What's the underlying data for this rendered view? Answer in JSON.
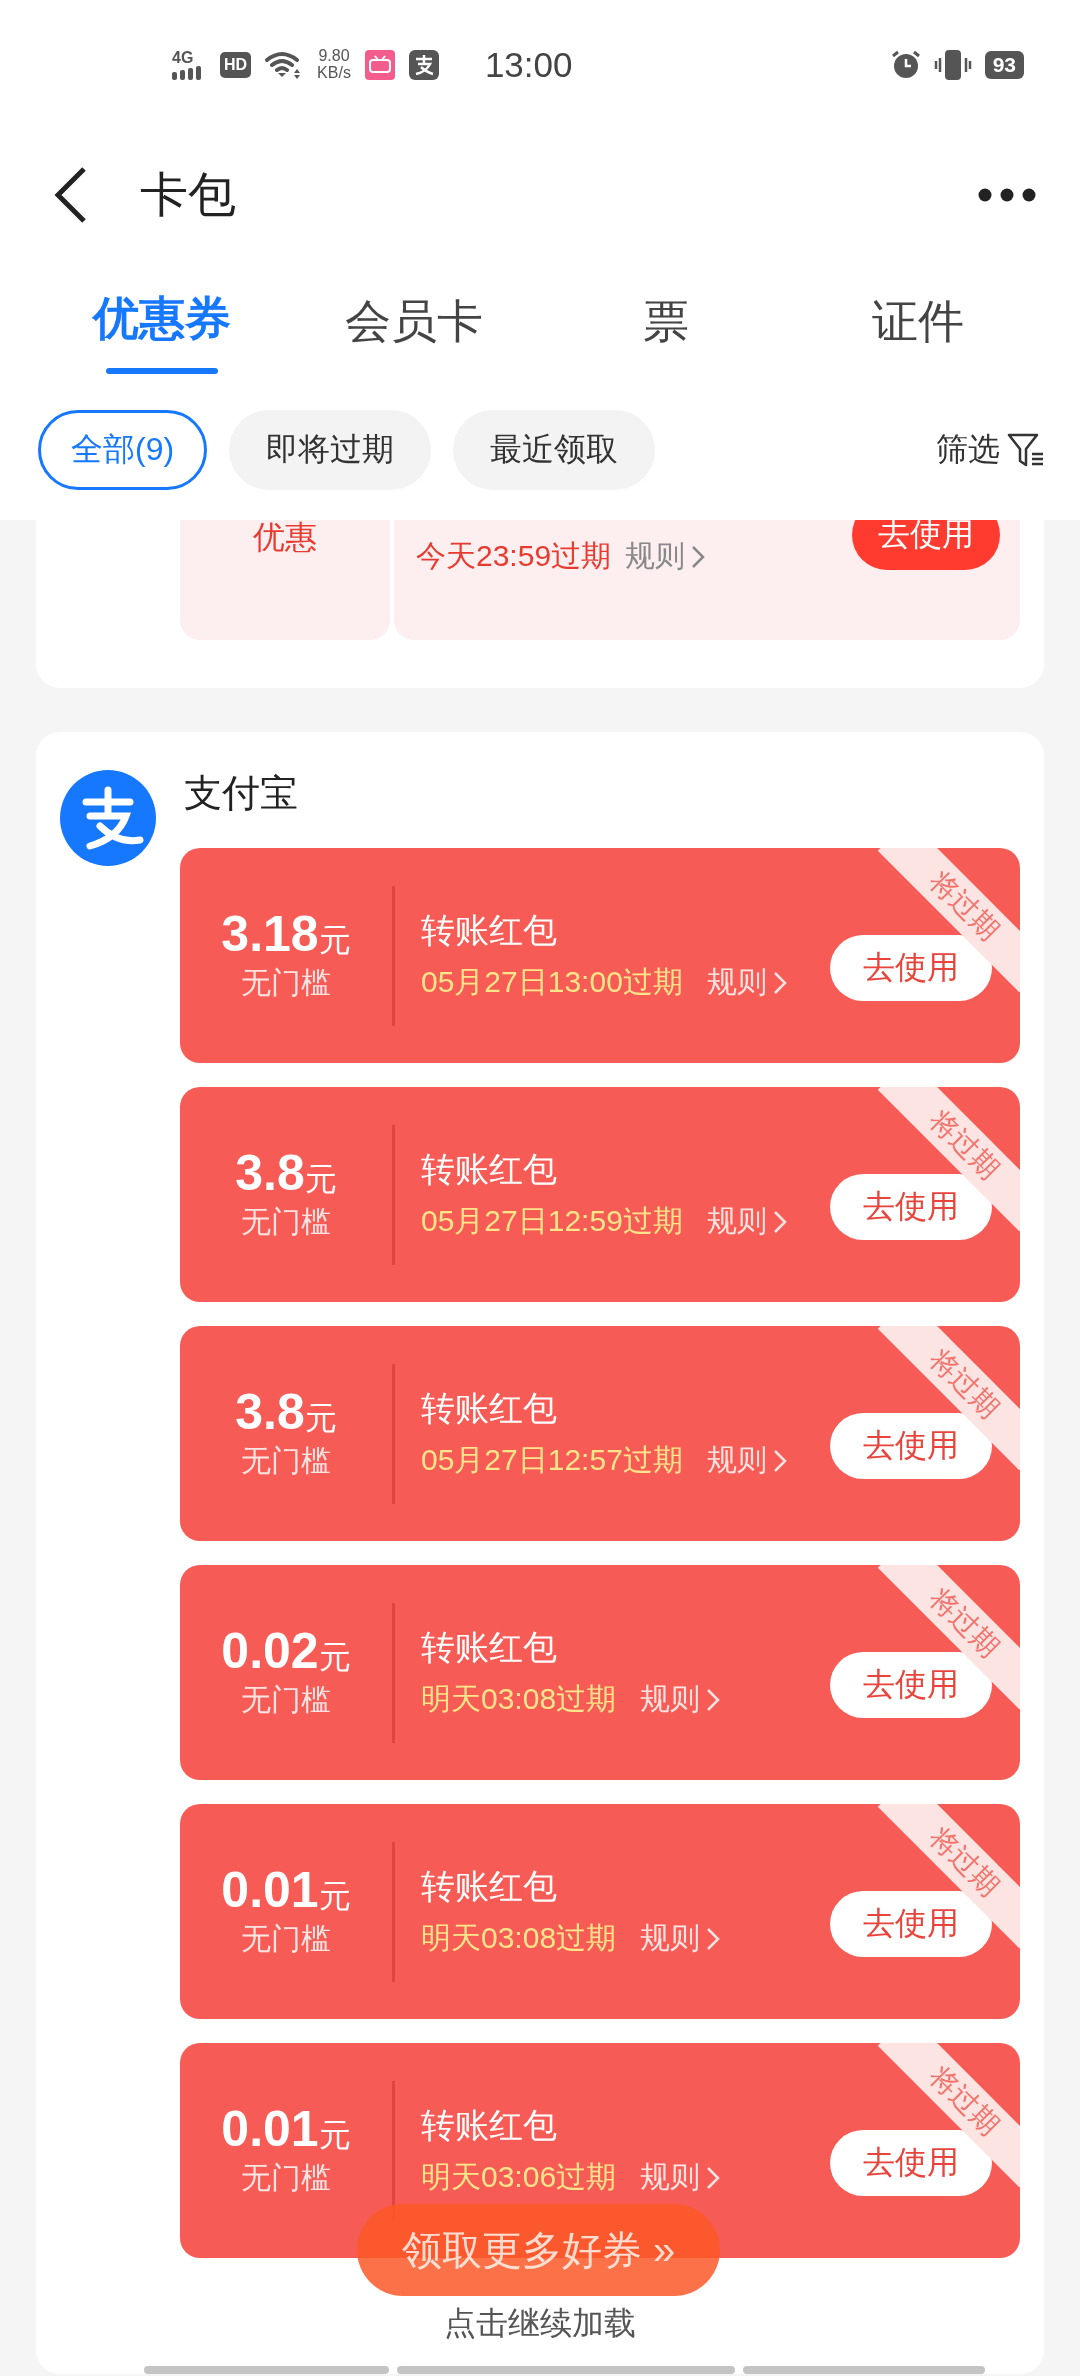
{
  "status_bar": {
    "network": "4G",
    "hd_badge": "HD",
    "speed": "9.80",
    "speed_unit": "KB/s",
    "time": "13:00",
    "battery": "93"
  },
  "header": {
    "title": "卡包"
  },
  "tabs": [
    {
      "label": "优惠券",
      "selected": true
    },
    {
      "label": "会员卡",
      "selected": false
    },
    {
      "label": "票",
      "selected": false
    },
    {
      "label": "证件",
      "selected": false
    }
  ],
  "filters": [
    {
      "label": "全部(9)",
      "selected": true
    },
    {
      "label": "即将过期",
      "selected": false
    },
    {
      "label": "最近领取",
      "selected": false
    }
  ],
  "filter_button": "筛选",
  "partial_coupon": {
    "left_label": "优惠",
    "expiry": "今天23:59过期",
    "rules": "规则",
    "action": "去使用"
  },
  "merchant": {
    "name": "支付宝",
    "coupons": [
      {
        "amount": "3.18",
        "unit": "元",
        "condition": "无门槛",
        "title": "转账红包",
        "expiry": "05月27日13:00过期",
        "rules": "规则",
        "action": "去使用",
        "tag": "将过期"
      },
      {
        "amount": "3.8",
        "unit": "元",
        "condition": "无门槛",
        "title": "转账红包",
        "expiry": "05月27日12:59过期",
        "rules": "规则",
        "action": "去使用",
        "tag": "将过期"
      },
      {
        "amount": "3.8",
        "unit": "元",
        "condition": "无门槛",
        "title": "转账红包",
        "expiry": "05月27日12:57过期",
        "rules": "规则",
        "action": "去使用",
        "tag": "将过期"
      },
      {
        "amount": "0.02",
        "unit": "元",
        "condition": "无门槛",
        "title": "转账红包",
        "expiry": "明天03:08过期",
        "rules": "规则",
        "action": "去使用",
        "tag": "将过期"
      },
      {
        "amount": "0.01",
        "unit": "元",
        "condition": "无门槛",
        "title": "转账红包",
        "expiry": "明天03:08过期",
        "rules": "规则",
        "action": "去使用",
        "tag": "将过期"
      },
      {
        "amount": "0.01",
        "unit": "元",
        "condition": "无门槛",
        "title": "转账红包",
        "expiry": "明天03:06过期",
        "rules": "规则",
        "action": "去使用",
        "tag": "将过期"
      }
    ]
  },
  "load_more": "点击继续加载",
  "floating_button": "领取更多好券 »"
}
